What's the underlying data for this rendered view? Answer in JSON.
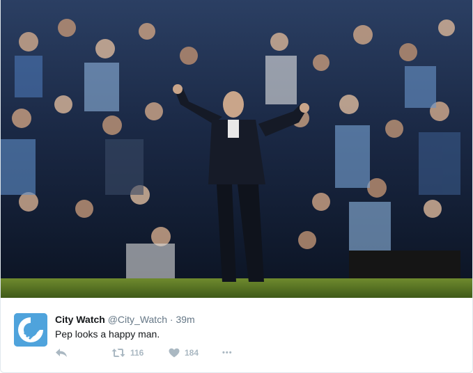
{
  "tweet": {
    "display_name": "City Watch",
    "handle": "@City_Watch",
    "separator": "·",
    "time": "39m",
    "text": "Pep looks a happy man.",
    "retweet_count": "116",
    "like_count": "184",
    "more_label": "•••"
  },
  "icons": {
    "reply": "reply-icon",
    "retweet": "retweet-icon",
    "like": "heart-icon",
    "more": "more-icon"
  },
  "colors": {
    "avatar_bg": "#4fa3dc",
    "action_gray": "#aab8c2",
    "text_primary": "#14171a",
    "text_secondary": "#657786"
  }
}
